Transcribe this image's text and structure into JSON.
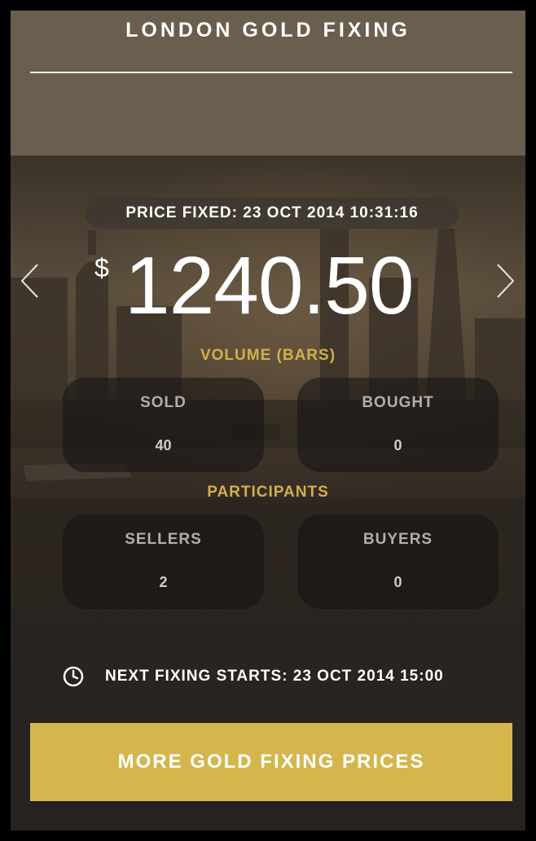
{
  "header": {
    "title": "LONDON GOLD FIXING"
  },
  "price_fixed": {
    "text": "PRICE FIXED: 23 OCT 2014 10:31:16"
  },
  "price": {
    "currency_symbol": "$",
    "value": "1240.50"
  },
  "navigation": {
    "prev_icon": "chevron-left-icon",
    "next_icon": "chevron-right-icon"
  },
  "volume": {
    "label": "VOLUME (BARS)",
    "sold": {
      "label": "SOLD",
      "value": "40"
    },
    "bought": {
      "label": "BOUGHT",
      "value": "0"
    }
  },
  "participants": {
    "label": "PARTICIPANTS",
    "sellers": {
      "label": "SELLERS",
      "value": "2"
    },
    "buyers": {
      "label": "BUYERS",
      "value": "0"
    }
  },
  "next_fixing": {
    "icon": "clock-icon",
    "text": "NEXT FIXING STARTS: 23 OCT 2014 15:00"
  },
  "cta": {
    "label": "MORE GOLD FIXING PRICES"
  },
  "colors": {
    "accent_gold": "#d4b64c",
    "label_gold": "#d1b04a",
    "header_bg": "#6a5f4e",
    "text": "#ffffff"
  }
}
